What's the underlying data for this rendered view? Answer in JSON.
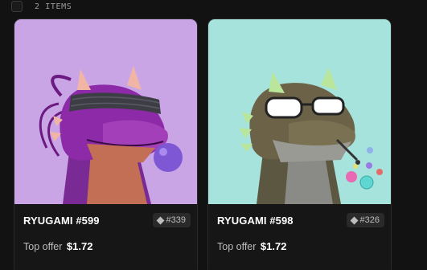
{
  "header": {
    "item_count": "2 ITEMS"
  },
  "colors": {
    "background": "#121212",
    "card_bg": "#1a1a1a",
    "card1_art_bg": "#c9a5e6",
    "card2_art_bg": "#a6e3dc",
    "muted_text": "#bdbdbd"
  },
  "cards": [
    {
      "name": "RYUGAMI #599",
      "rank": "#339",
      "offer_label": "Top offer",
      "offer_price": "$1.72",
      "image_subject": "purple dragon wearing a dark blindfold, blowing a purple bubble"
    },
    {
      "name": "RYUGAMI #598",
      "rank": "#326",
      "offer_label": "Top offer",
      "offer_price": "$1.72",
      "image_subject": "olive dragon wearing white-framed glasses, blowing colored bubbles from a pipe"
    }
  ]
}
